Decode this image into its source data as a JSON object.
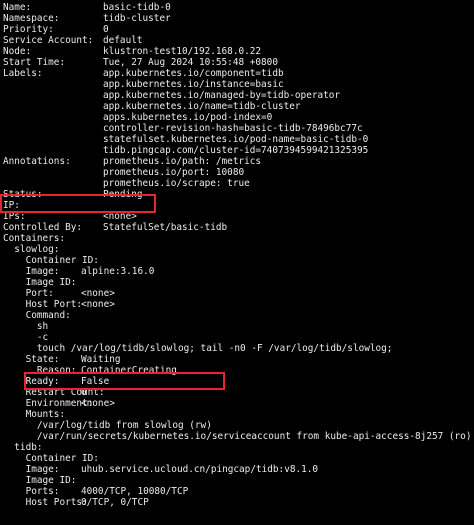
{
  "colors": {
    "background": "#000000",
    "text": "#ececec",
    "highlight": "#e8252f"
  },
  "lines": [
    {
      "k": "Name:",
      "v": "basic-tidb-0"
    },
    {
      "k": "Namespace:",
      "v": "tidb-cluster"
    },
    {
      "k": "Priority:",
      "v": "0"
    },
    {
      "k": "Service Account:",
      "v": "default"
    },
    {
      "k": "Node:",
      "v": "klustron-test10/192.168.0.22"
    },
    {
      "k": "Start Time:",
      "v": "Tue, 27 Aug 2024 10:55:48 +0800"
    },
    {
      "k": "Labels:",
      "v": "app.kubernetes.io/component=tidb"
    },
    {
      "k": "",
      "v": "app.kubernetes.io/instance=basic"
    },
    {
      "k": "",
      "v": "app.kubernetes.io/managed-by=tidb-operator"
    },
    {
      "k": "",
      "v": "app.kubernetes.io/name=tidb-cluster"
    },
    {
      "k": "",
      "v": "apps.kubernetes.io/pod-index=0"
    },
    {
      "k": "",
      "v": "controller-revision-hash=basic-tidb-78496bc77c"
    },
    {
      "k": "",
      "v": "statefulset.kubernetes.io/pod-name=basic-tidb-0"
    },
    {
      "k": "",
      "v": "tidb.pingcap.com/cluster-id=7407394599421325395"
    },
    {
      "k": "Annotations:",
      "v": "prometheus.io/path: /metrics"
    },
    {
      "k": "",
      "v": "prometheus.io/port: 10080"
    },
    {
      "k": "",
      "v": "prometheus.io/scrape: true"
    },
    {
      "k": "Status:",
      "v": "Pending"
    },
    {
      "k": "IP:",
      "v": ""
    },
    {
      "k": "IPs:",
      "v": "<none>"
    },
    {
      "k": "Controlled By:",
      "v": "StatefulSet/basic-tidb"
    },
    {
      "k": "Containers:",
      "v": ""
    },
    {
      "k": "  slowlog:",
      "v": ""
    },
    {
      "k": "    Container ID:",
      "v": ""
    },
    {
      "k": "    Image:",
      "v": "alpine:3.16.0"
    },
    {
      "k": "    Image ID:",
      "v": ""
    },
    {
      "k": "    Port:",
      "v": "<none>"
    },
    {
      "k": "    Host Port:",
      "v": "<none>"
    },
    {
      "k": "    Command:",
      "v": ""
    },
    {
      "k": "      sh",
      "v": ""
    },
    {
      "k": "      -c",
      "v": ""
    },
    {
      "k": "      touch /var/log/tidb/slowlog; tail -n0 -F /var/log/tidb/slowlog;",
      "v": ""
    },
    {
      "k": "    State:",
      "v": "Waiting"
    },
    {
      "k": "      Reason:",
      "v": "ContainerCreating"
    },
    {
      "k": "    Ready:",
      "v": "False"
    },
    {
      "k": "    Restart Count:",
      "v": "0"
    },
    {
      "k": "    Environment:",
      "v": "<none>"
    },
    {
      "k": "    Mounts:",
      "v": ""
    },
    {
      "k": "      /var/log/tidb from slowlog (rw)",
      "v": ""
    },
    {
      "k": "      /var/run/secrets/kubernetes.io/serviceaccount from kube-api-access-8j257 (ro)",
      "v": ""
    },
    {
      "k": "  tidb:",
      "v": ""
    },
    {
      "k": "    Container ID:",
      "v": ""
    },
    {
      "k": "    Image:",
      "v": "uhub.service.ucloud.cn/pingcap/tidb:v8.1.0"
    },
    {
      "k": "    Image ID:",
      "v": ""
    },
    {
      "k": "    Ports:",
      "v": "4000/TCP, 10080/TCP"
    },
    {
      "k": "    Host Ports:",
      "v": "0/TCP, 0/TCP"
    }
  ]
}
